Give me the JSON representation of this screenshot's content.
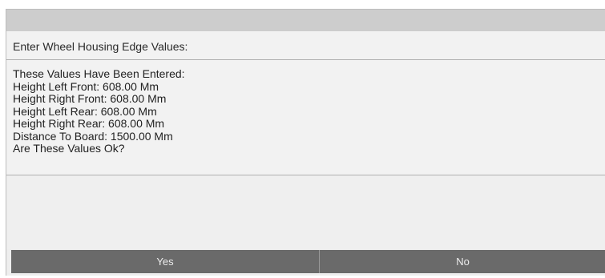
{
  "dialog": {
    "prompt": "Enter Wheel Housing Edge Values:",
    "message_lines": [
      "These Values Have Been Entered:",
      "Height Left Front: 608.00 Mm",
      "Height Right Front: 608.00 Mm",
      "Height Left Rear: 608.00 Mm",
      "Height Right Rear: 608.00 Mm",
      "Distance To Board: 1500.00 Mm",
      "Are These Values Ok?"
    ],
    "yes_label": "Yes",
    "no_label": "No"
  },
  "colors": {
    "title_bar": "#cdcdcd",
    "panel_background": "#eeeeee",
    "button_background": "#6a6a6a",
    "button_text": "#ededed"
  }
}
